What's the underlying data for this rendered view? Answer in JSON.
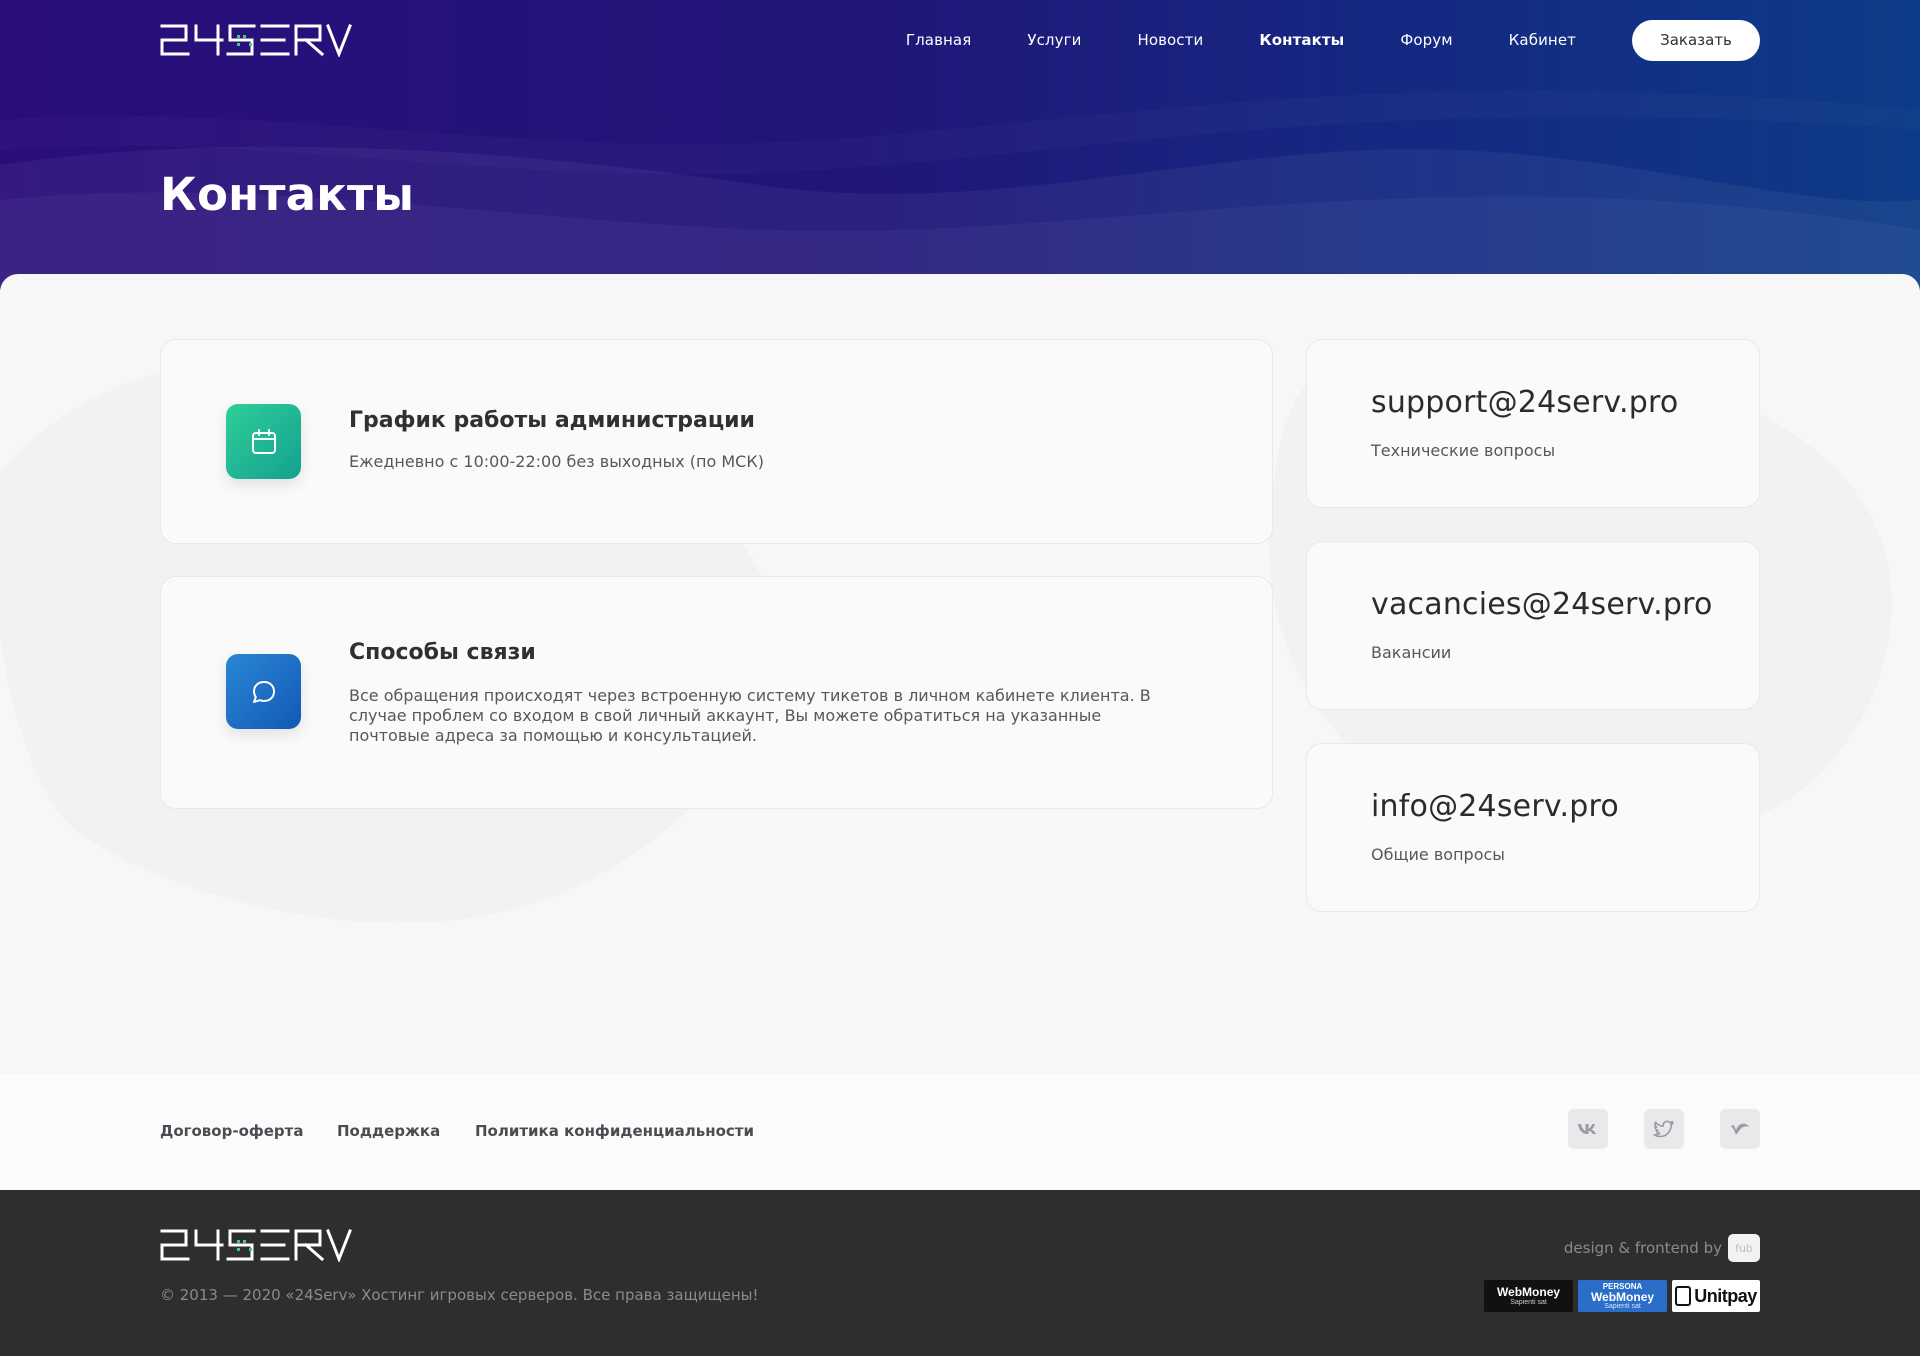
{
  "brand": {
    "logo_text": "24SERV"
  },
  "nav": {
    "items": [
      {
        "label": "Главная",
        "active": false
      },
      {
        "label": "Услуги",
        "active": false
      },
      {
        "label": "Новости",
        "active": false
      },
      {
        "label": "Контакты",
        "active": true
      },
      {
        "label": "Форум",
        "active": false
      },
      {
        "label": "Кабинет",
        "active": false
      }
    ],
    "order_button": "Заказать"
  },
  "page": {
    "title": "Контакты"
  },
  "info_cards": [
    {
      "icon": "calendar-icon",
      "title": "График работы администрации",
      "text": "Ежедневно с 10:00-22:00 без выходных (по МСК)"
    },
    {
      "icon": "chat-bubble-icon",
      "title": "Способы связи",
      "text": "Все обращения происходят через встроенную систему тикетов в личном кабинете клиента. В случае проблем со входом в свой личный аккаунт, Вы можете обратиться на указанные почтовые адреса за помощью и консультацией."
    }
  ],
  "emails": [
    {
      "email": "support@24serv.pro",
      "desc": "Технические вопросы"
    },
    {
      "email": "vacancies@24serv.pro",
      "desc": "Вакансии"
    },
    {
      "email": "info@24serv.pro",
      "desc": "Общие вопросы"
    }
  ],
  "footer": {
    "links": [
      "Договор-оферта",
      "Поддержка",
      "Политика конфиденциальности"
    ],
    "social": [
      "vk-icon",
      "twitter-icon",
      "vimeo-icon"
    ],
    "copyright": "© 2013 — 2020 «24Serv» Хостинг игровых серверов. Все права защищены!",
    "credit": "design & frontend by",
    "credit_badge": "fub",
    "payment_badges": [
      {
        "name": "WebMoney",
        "sub": "Sapienti sat"
      },
      {
        "top": "PERSONA",
        "name": "WebMoney",
        "sub": "Sapienti sat"
      },
      {
        "name": "Unitpay"
      }
    ]
  },
  "colors": {
    "hero_start": "#2b0d7a",
    "hero_end": "#0d3b87",
    "icon_green": "#1fb795",
    "icon_blue": "#1e6fc6",
    "footer_dark": "#2e2e2f",
    "logo_accent": "#3fd17a"
  }
}
